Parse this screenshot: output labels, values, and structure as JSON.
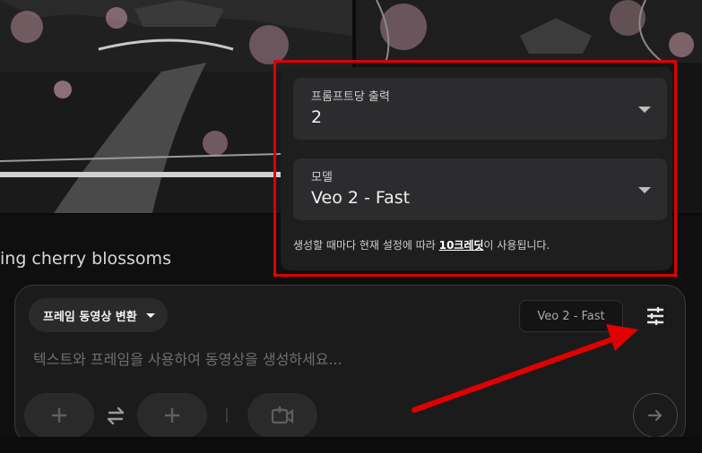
{
  "background": {
    "caption": "ing cherry blossoms"
  },
  "settings": {
    "outputs_label": "프롬프트당 출력",
    "outputs_value": "2",
    "model_label": "모델",
    "model_value": "Veo 2 - Fast",
    "note_prefix": "생성할 때마다 현재 설정에 따라 ",
    "note_credits": "10크레딧",
    "note_suffix": "이 사용됩니다."
  },
  "composer": {
    "mode_label": "프레임 동영상 변환",
    "model_chip": "Veo 2 - Fast",
    "placeholder": "텍스트와 프레임을 사용하여 동영상을 생성하세요..."
  },
  "icons": {
    "mode_caret": "caret-down-icon",
    "tune": "tune-sliders-icon",
    "add_frame": "plus-icon",
    "swap": "swap-arrows-icon",
    "add_video": "video-add-icon",
    "send": "arrow-right-icon",
    "dropdown": "triangle-down-icon"
  },
  "colors": {
    "annotation": "#e00000",
    "panel": "#1e1e1f",
    "field": "#2c2c2e",
    "composer": "#1b1b1c"
  }
}
